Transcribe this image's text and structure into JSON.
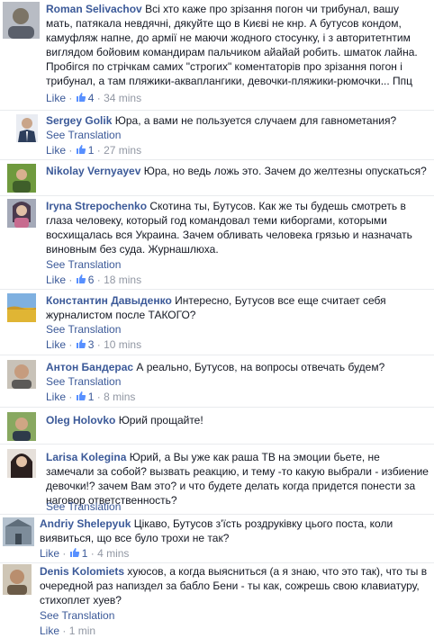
{
  "comments": [
    {
      "author": "Roman Selivachov",
      "text": "Всі хто каже про зрізання погон чи трибунал, вашу мать, патякала невдячні, дякуйте що в Києві не кнр. А бутусов кондом, камуфляж напне, до армії не маючи жодного стосунку, і з авторитетнтим виглядом бойовим командирам пальчиком айайай робить. шматок лайна. Пробігся по стрічкам самих \"строгих\" коментаторів про зрізання погон і трибунал, а там пляжики-акваплангики, девочки-пляжики-рюмочки... Ппц",
      "like": "Like",
      "likes": "4",
      "time": "34 mins",
      "avatar_color": "#8a8f99"
    },
    {
      "author": "Sergey Golik",
      "text": "Юра, а вами не пользуется случаем для гавнометания?",
      "see_translation": "See Translation",
      "like": "Like",
      "likes": "1",
      "time": "27 mins",
      "avatar_color": "#2d3e5c"
    },
    {
      "author": "Nikolay Vernyayev",
      "text": "Юра, но ведь ложь это. Зачем до желтезны опускаться?",
      "avatar_color": "#3f7a2e"
    },
    {
      "author": "Iryna Strepochenko",
      "text": "Скотина ты, Бутусов. Как же ты будешь смотреть в глаза человеку, который год командовал теми киборгами, которыми восхищалась вся Украина. Зачем обливать человека грязью и назначать виновным без суда. Журнашлюха.",
      "see_translation": "See Translation",
      "like": "Like",
      "likes": "6",
      "time": "18 mins",
      "avatar_color": "#7a6a84"
    },
    {
      "author": "Константин Давыденко",
      "text": "Интересно, Бутусов все еще считает себя журналистом после ТАКОГО?",
      "see_translation": "See Translation",
      "like": "Like",
      "likes": "3",
      "time": "10 mins",
      "avatar_color": "#c9a431"
    },
    {
      "author": "Антон Бандерас",
      "text": "А реально, Бутусов, на вопросы отвечать будем?",
      "see_translation": "See Translation",
      "like": "Like",
      "likes": "1",
      "time": "8 mins",
      "avatar_color": "#9a8a78"
    },
    {
      "author": "Oleg Holovko",
      "text": "Юрий прощайте!",
      "avatar_color": "#5d7f3c"
    },
    {
      "author": "Larisa Kolegina",
      "text": "Юрий, а Вы уже как раша ТВ на эмоции бьете, не замечали за собой? вызвать реакцию, и тему -то какую выбрали - избиение девочки!? зачем Вам это? и что будете делать когда придется понести за наговор ответственность?",
      "see_translation": "See Translation",
      "avatar_color": "#3a2c2a"
    },
    {
      "author": "Andriy Shelepyuk",
      "text": "Цікаво, Бутусов з'їсть роздруківку цього поста, коли виявиться, що все було трохи не так?",
      "like": "Like",
      "likes": "1",
      "time": "4 mins",
      "avatar_color": "#6e7e8e"
    },
    {
      "author": "Denis Kolomiets",
      "text": "хуюсов, а когда выясниться (а я знаю, что это так), что ты в очередной раз напиздел за бабло Бени - ты как, сожрешь свою клавиатуру, стихоплет хуев?",
      "see_translation": "See Translation",
      "like": "Like",
      "time": "1 min",
      "avatar_color": "#8a7a62"
    }
  ]
}
